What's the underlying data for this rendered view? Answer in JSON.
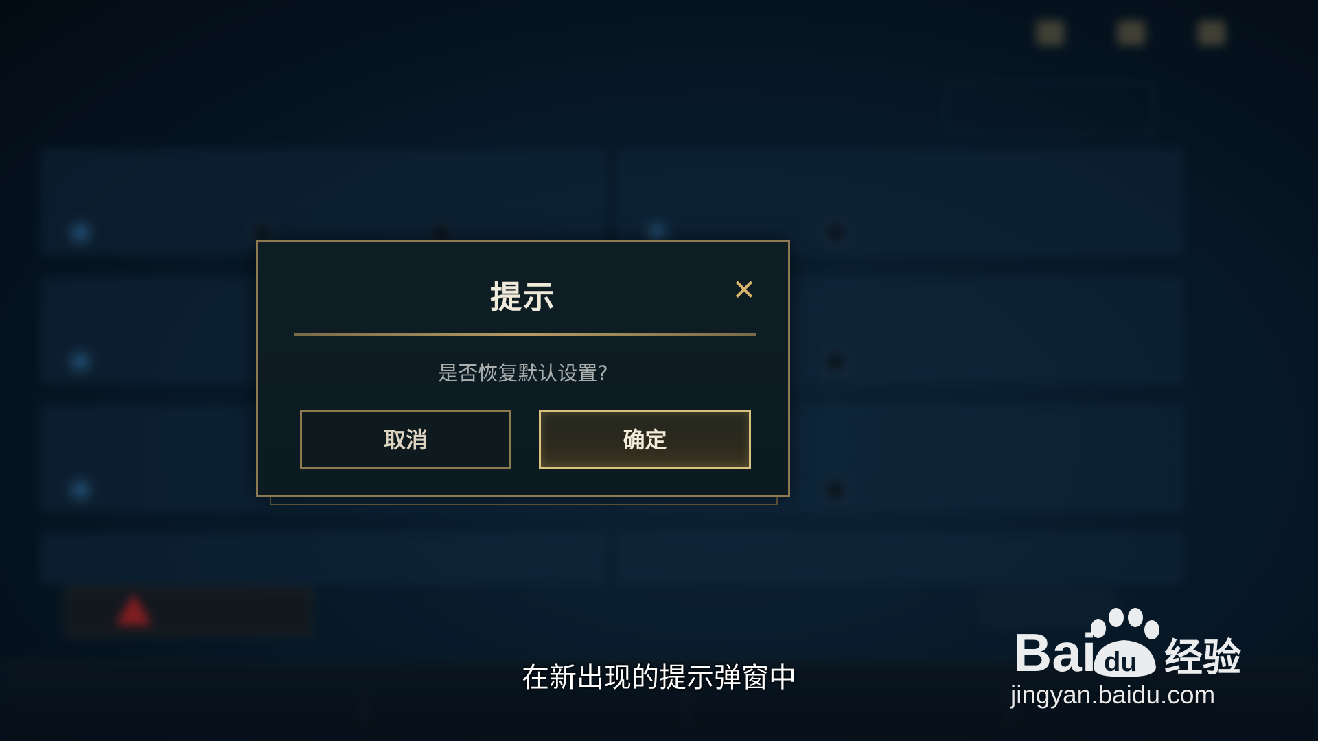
{
  "dialog": {
    "title": "提示",
    "close_glyph": "✕",
    "message": "是否恢复默认设置?",
    "cancel_label": "取消",
    "confirm_label": "确定"
  },
  "subtitle": "在新出现的提示弹窗中",
  "watermark": {
    "brand": "Bai",
    "brand_paw": "du",
    "brand_suffix": "经验",
    "url": "jingyan.baidu.com"
  },
  "icons": {
    "close": "close-icon",
    "warning": "warning-icon"
  },
  "colors": {
    "dialog_border": "#8d7a52",
    "confirm_border": "#d9c27e",
    "title_text": "#f0eadb",
    "close_icon": "#d6b56a",
    "warning_red": "#c0282b"
  }
}
